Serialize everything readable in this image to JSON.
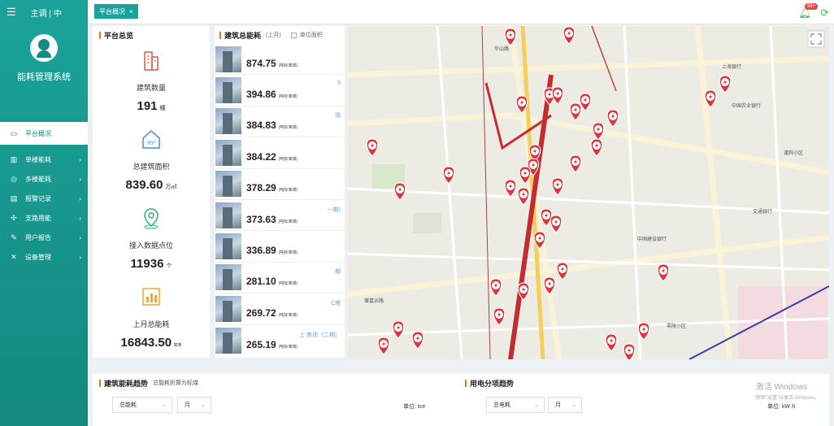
{
  "app": {
    "title": "能耗管理系统",
    "breadcrumb": "主调 | 中",
    "tab_label": "平台概况",
    "notifications_badge": "99+"
  },
  "sidebar": {
    "items": [
      {
        "label": "平台概况",
        "icon": "monitor-icon",
        "active": true
      },
      {
        "label": "单楼能耗",
        "icon": "building-icon",
        "arrow": "›"
      },
      {
        "label": "多楼能耗",
        "icon": "compass-icon",
        "arrow": "›"
      },
      {
        "label": "报警记录",
        "icon": "alarm-icon",
        "arrow": "›"
      },
      {
        "label": "支路用能",
        "icon": "branch-icon",
        "arrow": "›"
      },
      {
        "label": "用户报告",
        "icon": "report-icon",
        "arrow": "›"
      },
      {
        "label": "设备管理",
        "icon": "tools-icon",
        "arrow": "›"
      }
    ]
  },
  "overview": {
    "title": "平台总览",
    "stats": [
      {
        "label": "建筑数量",
        "value": "191",
        "unit": "幢",
        "icon": "buildings-icon"
      },
      {
        "label": "总建筑面积",
        "value": "839.60",
        "unit": "万㎡",
        "icon": "house-area-icon"
      },
      {
        "label": "接入数据点位",
        "value": "11936",
        "unit": "个",
        "icon": "location-pin-icon"
      },
      {
        "label": "上月总能耗",
        "value": "16843.50",
        "unit": "tce",
        "icon": "bar-chart-icon"
      }
    ]
  },
  "building_energy": {
    "title": "建筑总能耗",
    "subtitle": "(上月)",
    "checkbox_label": "单位面积",
    "unit_note": "(吨标准煤)",
    "items": [
      {
        "name": "",
        "value": "874.75"
      },
      {
        "name": "5",
        "value": "394.86"
      },
      {
        "name": "场",
        "value": "384.83"
      },
      {
        "name": "",
        "value": "384.22"
      },
      {
        "name": "",
        "value": "378.29"
      },
      {
        "name": "一期)",
        "value": "373.63"
      },
      {
        "name": "",
        "value": "336.89"
      },
      {
        "name": "期",
        "value": "281.10"
      },
      {
        "name": "C塔",
        "value": "269.72"
      },
      {
        "name": "上  商场（二期）",
        "value": "265.19"
      }
    ]
  },
  "map": {
    "labels": [
      {
        "text": "谨斜小区"
      },
      {
        "text": "零陵小区"
      },
      {
        "text": "中国建设银行"
      },
      {
        "text": "上海银行"
      },
      {
        "text": "中国农业银行"
      },
      {
        "text": "交通银行"
      },
      {
        "text": "肇嘉浜路"
      },
      {
        "text": "华山路"
      }
    ]
  },
  "trend": {
    "title": "建筑能耗趋势",
    "subtitle": "总能耗折算为标煤",
    "select1": "总能耗",
    "select2": "月",
    "unit": "单位:  tce"
  },
  "power": {
    "title": "用电分项趋势",
    "select1": "总电耗",
    "select2": "月",
    "unit": "单位:  kW·h"
  },
  "watermark": {
    "line1": "激活 Windows",
    "line2": "转到\"设置\"以激活 Windows。"
  },
  "colors": {
    "sidebar": "#1aa39a",
    "accent_orange": "#e8742a",
    "marker_red": "#d9363e",
    "marker_blue": "#3b8fe0"
  }
}
